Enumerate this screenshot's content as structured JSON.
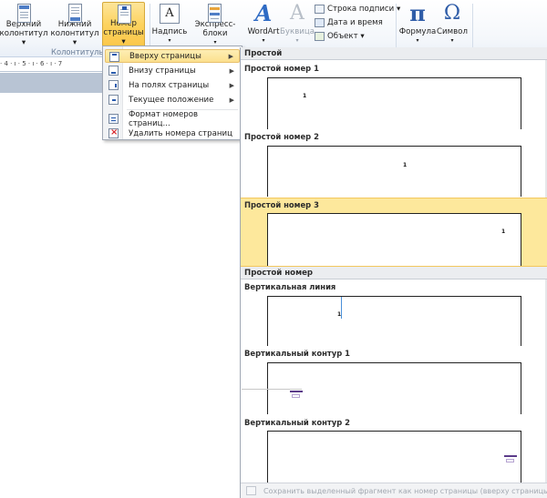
{
  "ribbon": {
    "header_btn": [
      "Верхний",
      "колонтитул ▾"
    ],
    "footer_btn": [
      "Нижний",
      "колонтитул ▾"
    ],
    "page_number_btn": [
      "Номер",
      "страницы ▾"
    ],
    "textbox_btn": [
      "Надпись",
      "▾"
    ],
    "quickparts_btn": [
      "Экспресс-блоки",
      "▾"
    ],
    "wordart_btn": [
      "WordArt",
      "▾"
    ],
    "dropcap_btn": [
      "Буквица",
      "▾"
    ],
    "signature_line": "Строка подписи ▾",
    "date_time": "Дата и время",
    "object": "Объект ▾",
    "formula_btn": [
      "Формула",
      "▾"
    ],
    "symbol_btn": [
      "Символ",
      "▾"
    ],
    "group_label": "Колонтитулы",
    "pi_glyph": "π",
    "omega_glyph": "Ω",
    "textbox_glyph": "A",
    "wordart_glyph": "A",
    "dropcap_glyph": "A"
  },
  "ruler": {
    "marks": "· 4 · ı · 5 · ı · 6 · ı · 7"
  },
  "menu": {
    "items": [
      {
        "label": "Вверху страницы",
        "submenu": "▶"
      },
      {
        "label": "Внизу страницы",
        "submenu": "▶"
      },
      {
        "label": "На полях страницы",
        "submenu": "▶"
      },
      {
        "label": "Текущее положение",
        "submenu": "▶"
      },
      {
        "label": "Формат номеров страниц..."
      },
      {
        "label": "Удалить номера страниц"
      }
    ]
  },
  "gallery": {
    "sec1": "Простой",
    "items1": [
      "Простой номер 1",
      "Простой номер 2",
      "Простой номер 3"
    ],
    "sec2": "Простой номер",
    "items2": [
      "Вертикальная линия",
      "Вертикальный контур 1",
      "Вертикальный контур 2"
    ],
    "page_number": "1",
    "footer": "Сохранить выделенный фрагмент как номер страницы (вверху страницы)"
  },
  "colors": {
    "accent": "#fde89c",
    "ribbon_active": "#fdd35f",
    "vertical_line": "#4a90d9",
    "contour": "#5b3b8a"
  }
}
